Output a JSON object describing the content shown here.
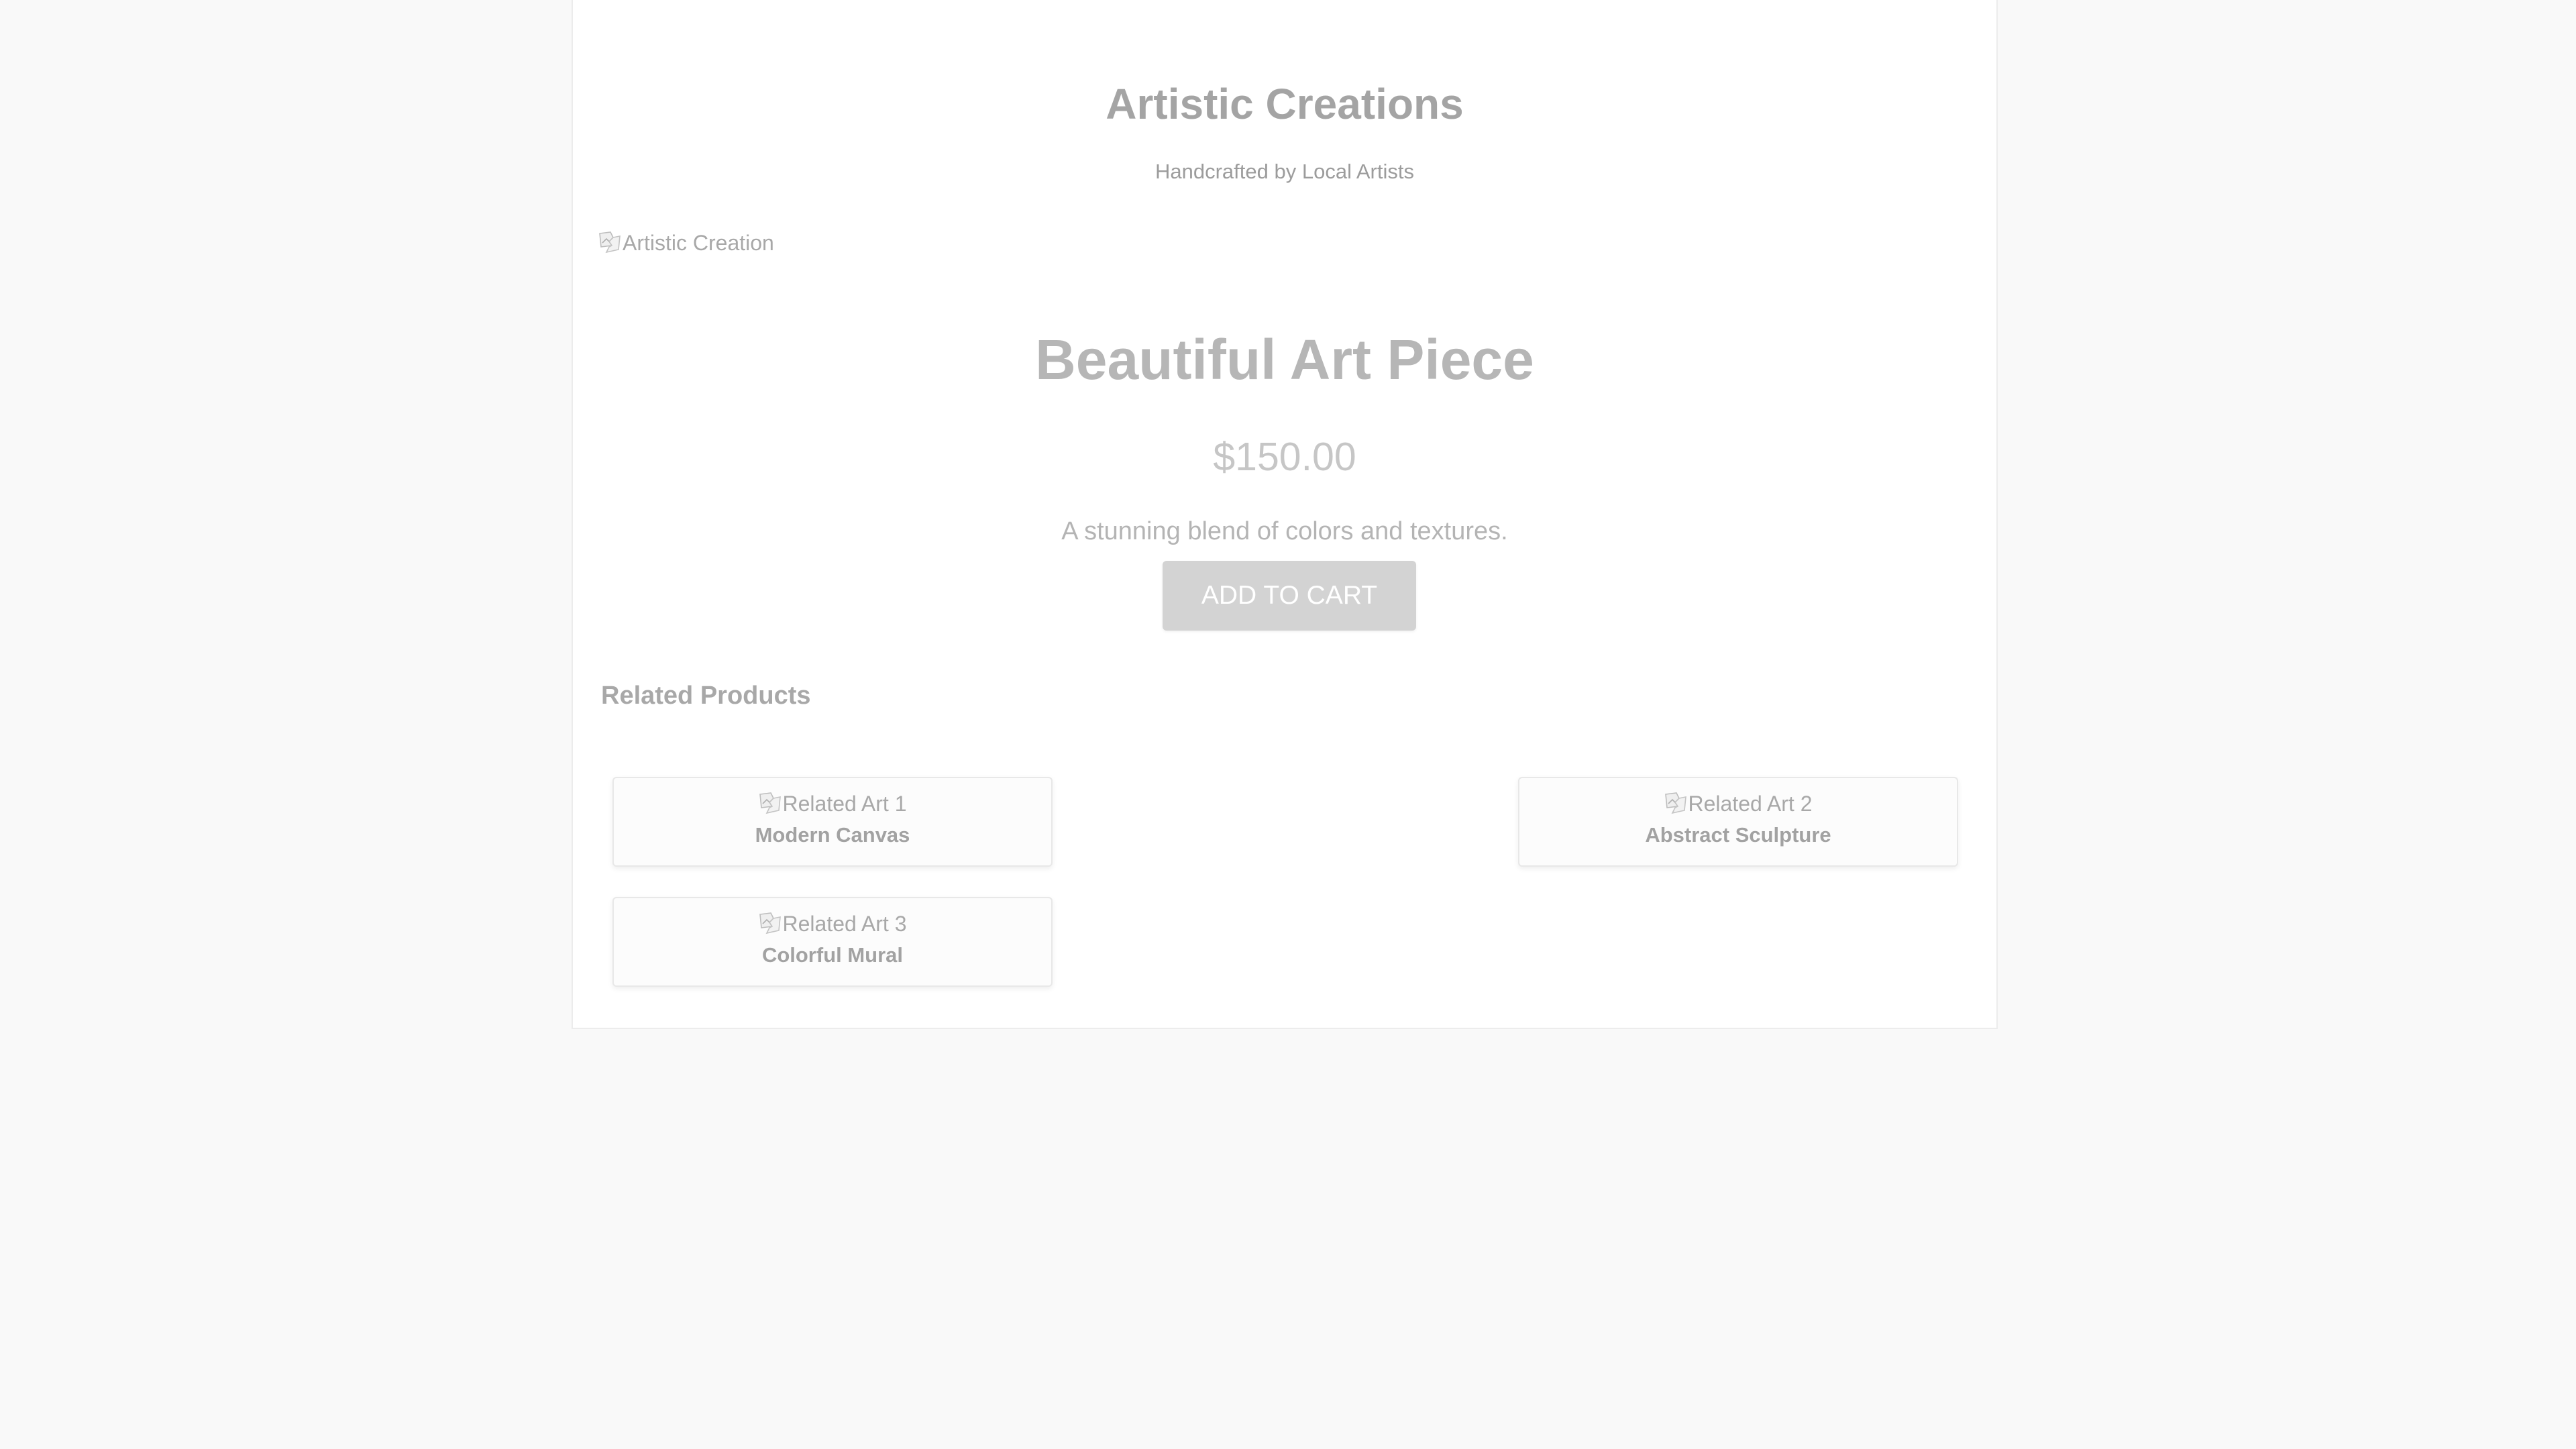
{
  "header": {
    "title": "Artistic Creations",
    "tagline": "Handcrafted by Local Artists"
  },
  "product": {
    "image_alt": "Artistic Creation",
    "name": "Beautiful Art Piece",
    "price": "$150.00",
    "description": "A stunning blend of colors and textures.",
    "add_to_cart_label": "ADD TO CART"
  },
  "related": {
    "heading": "Related Products",
    "items": [
      {
        "image_alt": "Related Art 1",
        "name": "Modern Canvas"
      },
      {
        "image_alt": "Related Art 2",
        "name": "Abstract Sculpture"
      },
      {
        "image_alt": "Related Art 3",
        "name": "Colorful Mural"
      }
    ]
  },
  "colors": {
    "page_background": "#f9f9f9",
    "content_background": "#ffffff",
    "button_background": "#d3d3d3",
    "button_text": "#ffffff"
  },
  "icons": {
    "broken_image": "broken-image-icon"
  }
}
